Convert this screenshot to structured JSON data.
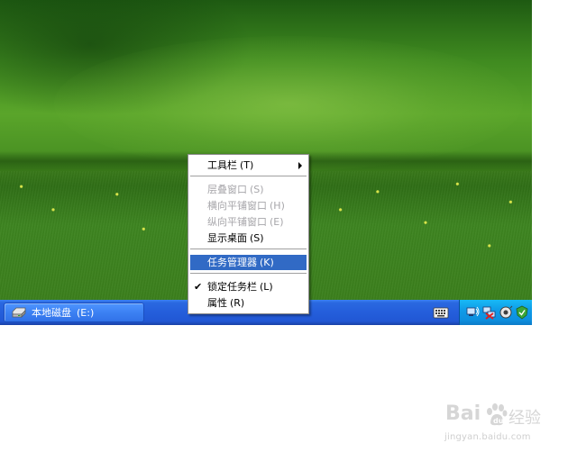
{
  "taskbar": {
    "window_button": {
      "label": "本地磁盘",
      "drive": "(E:)",
      "icon": "drive-icon"
    },
    "tray": {
      "icons": [
        "network-icon",
        "network-disconnected-icon",
        "volume-icon",
        "security-icon"
      ]
    },
    "language_bar_icon": "keyboard-icon"
  },
  "context_menu": {
    "items": [
      {
        "label": "工具栏",
        "accel": "(T)",
        "state": "enabled",
        "has_submenu": true
      },
      {
        "label": "层叠窗口",
        "accel": "(S)",
        "state": "disabled"
      },
      {
        "label": "横向平铺窗口",
        "accel": "(H)",
        "state": "disabled"
      },
      {
        "label": "纵向平铺窗口",
        "accel": "(E)",
        "state": "disabled"
      },
      {
        "label": "显示桌面",
        "accel": "(S)",
        "state": "enabled"
      },
      {
        "label": "任务管理器",
        "accel": "(K)",
        "state": "highlighted"
      },
      {
        "label": "锁定任务栏",
        "accel": "(L)",
        "state": "enabled",
        "checked": true
      },
      {
        "label": "属性",
        "accel": "(R)",
        "state": "enabled"
      }
    ]
  },
  "watermark": {
    "brand": "Bai",
    "text": "经验",
    "url": "jingyan.baidu.com"
  },
  "colors": {
    "taskbar_blue": "#245edb",
    "tray_blue": "#0f9ce8",
    "menu_highlight": "#316ac5",
    "disabled_text": "#a7a6aa"
  }
}
